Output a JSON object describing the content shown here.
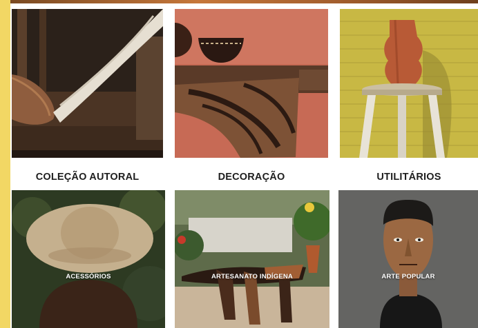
{
  "categories": [
    {
      "label": "COLEÇÃO AUTORAL"
    },
    {
      "label": "DECORAÇÃO"
    },
    {
      "label": "UTILITÁRIOS"
    },
    {
      "label": "ACESSÓRIOS"
    },
    {
      "label": "ARTESANATO INDÍGENA"
    },
    {
      "label": "ARTE POPULAR"
    }
  ],
  "colors": {
    "side_strip": "#f2d764",
    "label_dark": "#1e1e1e",
    "label_overlay": "#ffffff"
  }
}
